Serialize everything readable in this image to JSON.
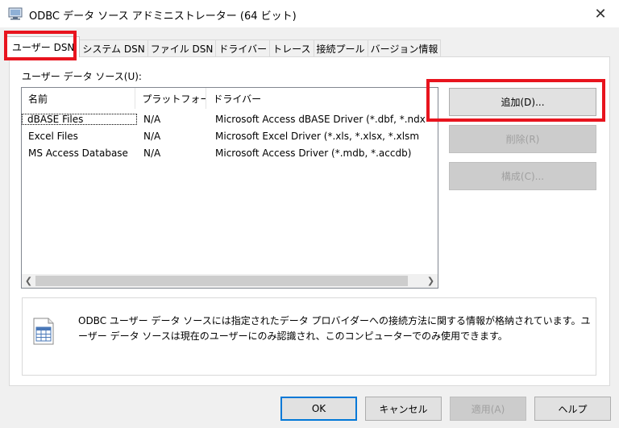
{
  "window": {
    "title": "ODBC データ ソース アドミニストレーター (64 ビット)",
    "close_glyph": "✕"
  },
  "tabs": [
    {
      "label": "ユーザー DSN",
      "active": true
    },
    {
      "label": "システム DSN"
    },
    {
      "label": "ファイル DSN"
    },
    {
      "label": "ドライバー"
    },
    {
      "label": "トレース"
    },
    {
      "label": "接続プール"
    },
    {
      "label": "バージョン情報"
    }
  ],
  "group_label": "ユーザー データ ソース(U):",
  "list": {
    "columns": [
      "名前",
      "プラットフォーム",
      "ドライバー"
    ],
    "rows": [
      {
        "name": "dBASE Files",
        "platform": "N/A",
        "driver": "Microsoft Access dBASE Driver (*.dbf, *.ndx"
      },
      {
        "name": "Excel Files",
        "platform": "N/A",
        "driver": "Microsoft Excel Driver (*.xls, *.xlsx, *.xlsm"
      },
      {
        "name": "MS Access Database",
        "platform": "N/A",
        "driver": "Microsoft Access Driver (*.mdb, *.accdb)"
      }
    ]
  },
  "side_buttons": {
    "add": "追加(D)...",
    "remove": "削除(R)",
    "configure": "構成(C)..."
  },
  "info_text": "ODBC ユーザー データ ソースには指定されたデータ プロバイダーへの接続方法に関する情報が格納されています。ユーザー データ ソースは現在のユーザーにのみ認識され、このコンピューターでのみ使用できます。",
  "bottom_buttons": {
    "ok": "OK",
    "cancel": "キャンセル",
    "apply": "適用(A)",
    "help": "ヘルプ"
  },
  "highlight_color": "#e8141e"
}
